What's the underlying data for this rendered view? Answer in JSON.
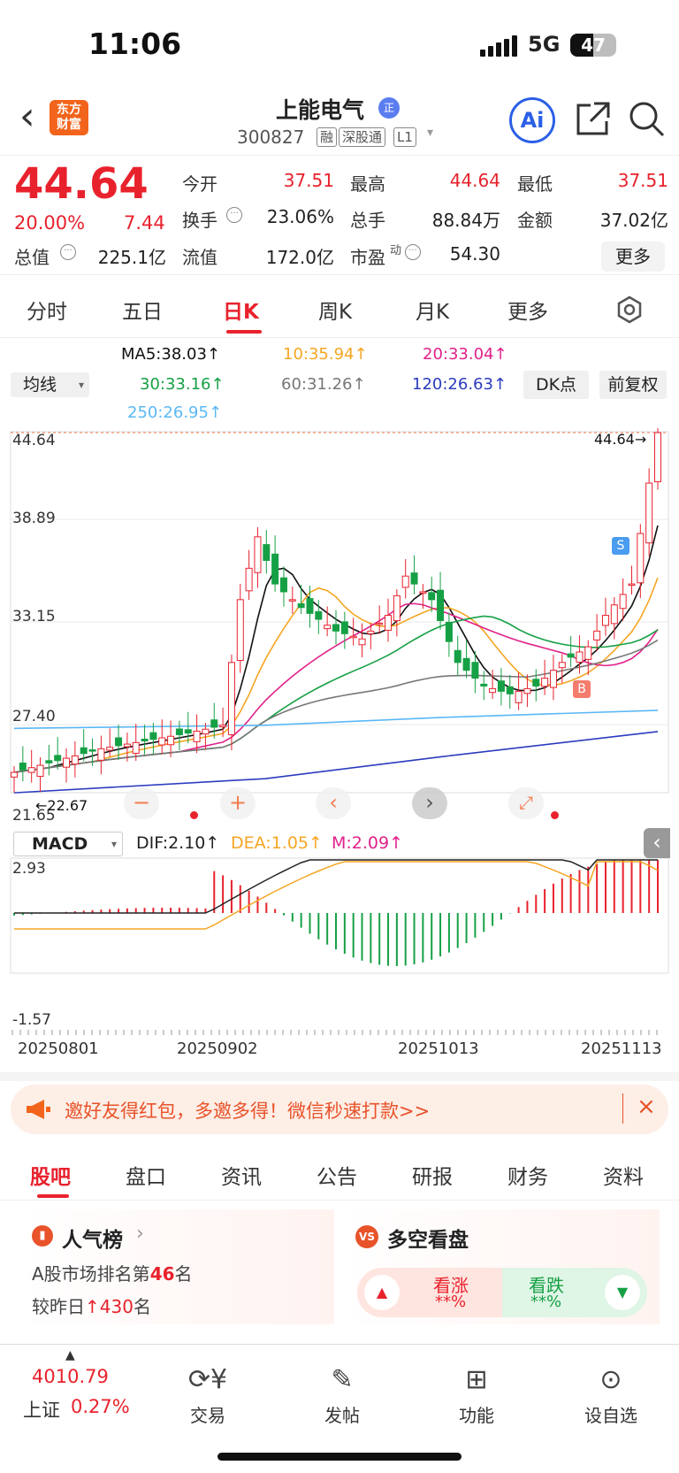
{
  "status": {
    "time": "11:06",
    "network": "5G",
    "battery": "47"
  },
  "header": {
    "back_icon": "chevron-left-icon",
    "logo_line1": "东方",
    "logo_line2": "财富",
    "name": "上能电气",
    "verified_badge": "正",
    "code": "300827",
    "tags": [
      "融",
      "深股通",
      "L1"
    ],
    "ai_label": "Ai",
    "share_icon": "share-icon",
    "search_icon": "search-icon"
  },
  "quote": {
    "price": "44.64",
    "change_pct": "20.00%",
    "change": "7.44",
    "open_label": "今开",
    "open": "37.51",
    "high_label": "最高",
    "high": "44.64",
    "low_label": "最低",
    "low": "37.51",
    "turnover_label": "换手",
    "turnover": "23.06%",
    "volume_label": "总手",
    "volume": "88.84万",
    "amount_label": "金额",
    "amount": "37.02亿",
    "mktcap_label": "总值",
    "mktcap": "225.1亿",
    "float_label": "流值",
    "float": "172.0亿",
    "pe_label": "市盈",
    "pe_sup": "动",
    "pe": "54.30",
    "more_label": "更多"
  },
  "tabs": [
    "分时",
    "五日",
    "日K",
    "周K",
    "月K",
    "更多"
  ],
  "active_tab": "日K",
  "ma": {
    "selector": "均线",
    "ma5": "MA5:38.03↑",
    "ma10": "10:35.94↑",
    "ma20": "20:33.04↑",
    "ma30": "30:33.16↑",
    "ma60": "60:31.26↑",
    "ma120": "120:26.63↑",
    "ma250": "250:26.95↑",
    "dk_label": "DK点",
    "fq_label": "前复权",
    "colors": {
      "ma5": "#111111",
      "ma10": "#f5a623",
      "ma20": "#e0218a",
      "ma30": "#16a045",
      "ma60": "#777777",
      "ma120": "#2b3bbf",
      "ma250": "#5ab8f5"
    }
  },
  "kline": {
    "y_labels": [
      "44.64",
      "38.89",
      "33.15",
      "27.40",
      "21.65"
    ],
    "high_marker": "44.64",
    "low_marker": "22.67",
    "signal_s": "S",
    "signal_b": "B"
  },
  "macd": {
    "selector": "MACD",
    "dif": "DIF:2.10↑",
    "dea": "DEA:1.05↑",
    "m": "M:2.09↑",
    "y_top": "2.93",
    "y_bottom": "-1.57",
    "dates": [
      "20250801",
      "20250902",
      "20251013",
      "20251113"
    ]
  },
  "banner": {
    "text": "邀好友得红包，多邀多得！微信秒速打款>>",
    "close": "×"
  },
  "guba_tabs": [
    "股吧",
    "盘口",
    "资讯",
    "公告",
    "研报",
    "财务",
    "资料"
  ],
  "active_guba": "股吧",
  "popularity": {
    "title": "人气榜",
    "rank_text_prefix": "A股市场排名第",
    "rank": "46",
    "rank_suffix": "名",
    "change_prefix": "较昨日",
    "change": "430",
    "change_suffix": "名"
  },
  "bullbear": {
    "title": "多空看盘",
    "up_label": "看涨",
    "up_value": "**%",
    "down_label": "看跌",
    "down_value": "**%"
  },
  "bottom": {
    "index_value": "4010.79",
    "index_name": "上证",
    "index_change": "0.27%",
    "items": [
      "交易",
      "发帖",
      "功能",
      "设自选"
    ]
  }
}
